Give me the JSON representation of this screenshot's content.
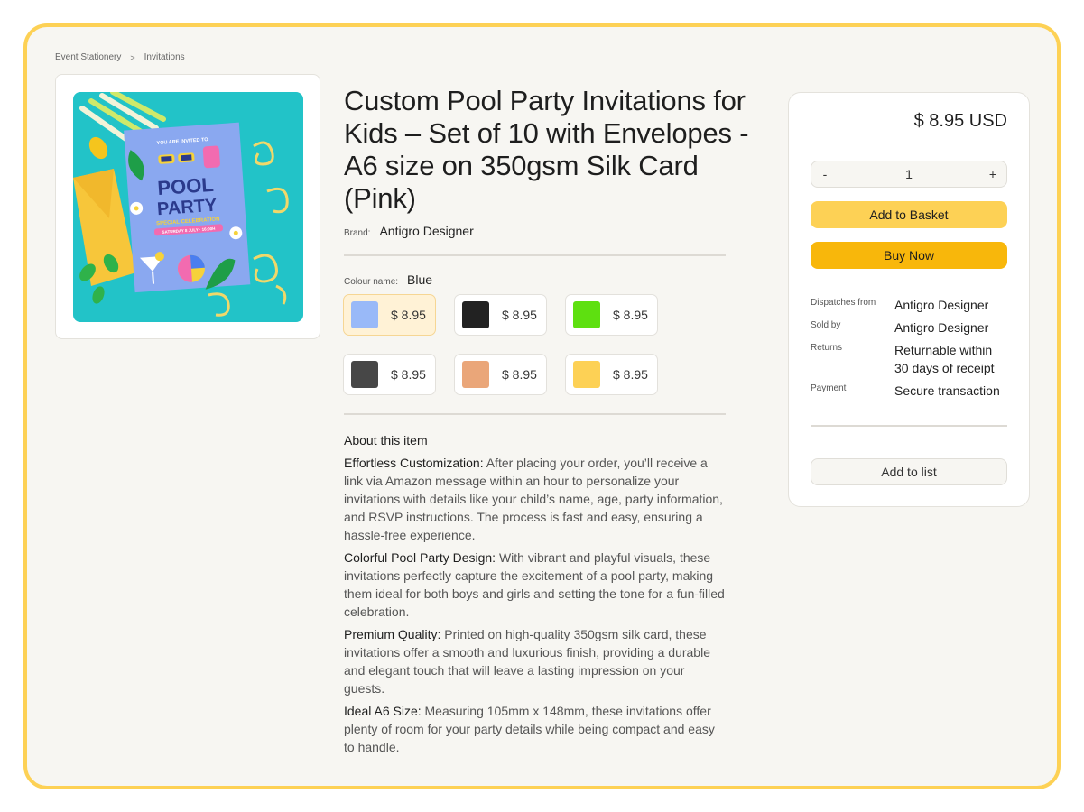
{
  "breadcrumb": {
    "items": [
      "Event Stationery",
      "Invitations"
    ],
    "separator": ">"
  },
  "product": {
    "title": "Custom Pool Party Invitations for Kids – Set of 10 with Envelopes - A6 size on 350gsm Silk Card (Pink)",
    "brand_label": "Brand:",
    "brand": "Antigro Designer",
    "image_alt": "Pool party invitation card on blue background",
    "image_text": {
      "top": "YOU ARE INVITED TO",
      "line1": "POOL",
      "line2": "PARTY",
      "line3": "SPECIAL CELEBRATION",
      "date": "SATURDAY 8 JULY · 16:00H"
    }
  },
  "colour": {
    "label": "Colour name:",
    "value": "Blue",
    "swatches": [
      {
        "color": "#99b9f8",
        "price": "$ 8.95",
        "selected": true
      },
      {
        "color": "#222222",
        "price": "$ 8.95",
        "selected": false
      },
      {
        "color": "#5ee010",
        "price": "$ 8.95",
        "selected": false
      },
      {
        "color": "#474747",
        "price": "$ 8.95",
        "selected": false
      },
      {
        "color": "#eaa679",
        "price": "$ 8.95",
        "selected": false
      },
      {
        "color": "#fdd155",
        "price": "$ 8.95",
        "selected": false
      }
    ]
  },
  "about": {
    "heading": "About this item",
    "items": [
      {
        "lead": "Effortless Customization:",
        "text": " After placing your order, you’ll receive a link via Amazon message within an hour to personalize your invitations with details like your child’s name, age, party information, and RSVP instructions. The process is fast and easy, ensuring a hassle-free experience."
      },
      {
        "lead": "Colorful Pool Party Design:",
        "text": " With vibrant and playful visuals, these invitations perfectly capture the excitement of a pool party, making them ideal for both boys and girls and setting the tone for a fun-filled celebration."
      },
      {
        "lead": "Premium Quality:",
        "text": " Printed on high-quality 350gsm silk card, these invitations offer a smooth and luxurious finish, providing a durable and elegant touch that will leave a lasting impression on your guests."
      },
      {
        "lead": "Ideal A6 Size:",
        "text": " Measuring 105mm x 148mm, these invitations offer plenty of room for your party details while being compact and easy to handle."
      }
    ]
  },
  "buybox": {
    "price": "$ 8.95 USD",
    "qty": {
      "minus": "-",
      "value": "1",
      "plus": "+"
    },
    "add_to_basket": "Add to Basket",
    "buy_now": "Buy Now",
    "info": [
      {
        "label": "Dispatches from",
        "value": "Antigro Designer"
      },
      {
        "label": "Sold by",
        "value": "Antigro Designer"
      },
      {
        "label": "Returns",
        "value": "Returnable within 30 days of receipt"
      },
      {
        "label": "Payment",
        "value": "Secure transaction"
      }
    ],
    "add_to_list": "Add to list"
  },
  "colors": {
    "accent": "#fdd155",
    "buy": "#f8b70b",
    "frame_bg": "#f7f6f2"
  }
}
